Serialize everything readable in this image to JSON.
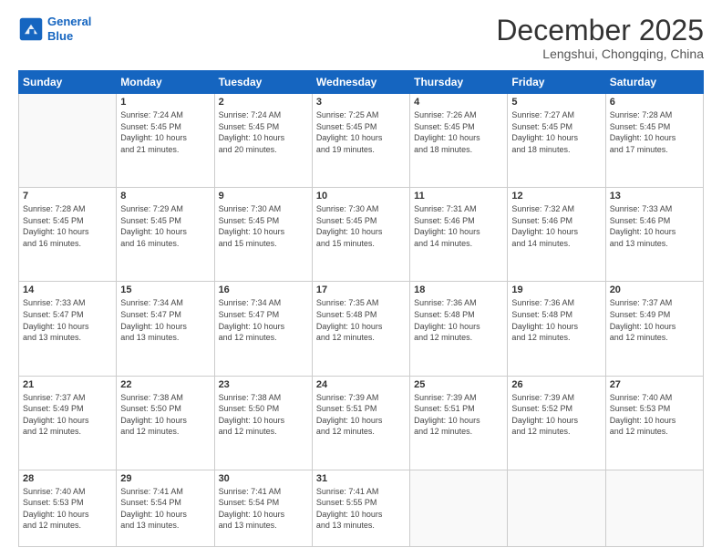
{
  "logo": {
    "line1": "General",
    "line2": "Blue"
  },
  "header": {
    "month": "December 2025",
    "location": "Lengshui, Chongqing, China"
  },
  "weekdays": [
    "Sunday",
    "Monday",
    "Tuesday",
    "Wednesday",
    "Thursday",
    "Friday",
    "Saturday"
  ],
  "weeks": [
    [
      {
        "day": "",
        "info": ""
      },
      {
        "day": "1",
        "info": "Sunrise: 7:24 AM\nSunset: 5:45 PM\nDaylight: 10 hours\nand 21 minutes."
      },
      {
        "day": "2",
        "info": "Sunrise: 7:24 AM\nSunset: 5:45 PM\nDaylight: 10 hours\nand 20 minutes."
      },
      {
        "day": "3",
        "info": "Sunrise: 7:25 AM\nSunset: 5:45 PM\nDaylight: 10 hours\nand 19 minutes."
      },
      {
        "day": "4",
        "info": "Sunrise: 7:26 AM\nSunset: 5:45 PM\nDaylight: 10 hours\nand 18 minutes."
      },
      {
        "day": "5",
        "info": "Sunrise: 7:27 AM\nSunset: 5:45 PM\nDaylight: 10 hours\nand 18 minutes."
      },
      {
        "day": "6",
        "info": "Sunrise: 7:28 AM\nSunset: 5:45 PM\nDaylight: 10 hours\nand 17 minutes."
      }
    ],
    [
      {
        "day": "7",
        "info": "Sunrise: 7:28 AM\nSunset: 5:45 PM\nDaylight: 10 hours\nand 16 minutes."
      },
      {
        "day": "8",
        "info": "Sunrise: 7:29 AM\nSunset: 5:45 PM\nDaylight: 10 hours\nand 16 minutes."
      },
      {
        "day": "9",
        "info": "Sunrise: 7:30 AM\nSunset: 5:45 PM\nDaylight: 10 hours\nand 15 minutes."
      },
      {
        "day": "10",
        "info": "Sunrise: 7:30 AM\nSunset: 5:45 PM\nDaylight: 10 hours\nand 15 minutes."
      },
      {
        "day": "11",
        "info": "Sunrise: 7:31 AM\nSunset: 5:46 PM\nDaylight: 10 hours\nand 14 minutes."
      },
      {
        "day": "12",
        "info": "Sunrise: 7:32 AM\nSunset: 5:46 PM\nDaylight: 10 hours\nand 14 minutes."
      },
      {
        "day": "13",
        "info": "Sunrise: 7:33 AM\nSunset: 5:46 PM\nDaylight: 10 hours\nand 13 minutes."
      }
    ],
    [
      {
        "day": "14",
        "info": "Sunrise: 7:33 AM\nSunset: 5:47 PM\nDaylight: 10 hours\nand 13 minutes."
      },
      {
        "day": "15",
        "info": "Sunrise: 7:34 AM\nSunset: 5:47 PM\nDaylight: 10 hours\nand 13 minutes."
      },
      {
        "day": "16",
        "info": "Sunrise: 7:34 AM\nSunset: 5:47 PM\nDaylight: 10 hours\nand 12 minutes."
      },
      {
        "day": "17",
        "info": "Sunrise: 7:35 AM\nSunset: 5:48 PM\nDaylight: 10 hours\nand 12 minutes."
      },
      {
        "day": "18",
        "info": "Sunrise: 7:36 AM\nSunset: 5:48 PM\nDaylight: 10 hours\nand 12 minutes."
      },
      {
        "day": "19",
        "info": "Sunrise: 7:36 AM\nSunset: 5:48 PM\nDaylight: 10 hours\nand 12 minutes."
      },
      {
        "day": "20",
        "info": "Sunrise: 7:37 AM\nSunset: 5:49 PM\nDaylight: 10 hours\nand 12 minutes."
      }
    ],
    [
      {
        "day": "21",
        "info": "Sunrise: 7:37 AM\nSunset: 5:49 PM\nDaylight: 10 hours\nand 12 minutes."
      },
      {
        "day": "22",
        "info": "Sunrise: 7:38 AM\nSunset: 5:50 PM\nDaylight: 10 hours\nand 12 minutes."
      },
      {
        "day": "23",
        "info": "Sunrise: 7:38 AM\nSunset: 5:50 PM\nDaylight: 10 hours\nand 12 minutes."
      },
      {
        "day": "24",
        "info": "Sunrise: 7:39 AM\nSunset: 5:51 PM\nDaylight: 10 hours\nand 12 minutes."
      },
      {
        "day": "25",
        "info": "Sunrise: 7:39 AM\nSunset: 5:51 PM\nDaylight: 10 hours\nand 12 minutes."
      },
      {
        "day": "26",
        "info": "Sunrise: 7:39 AM\nSunset: 5:52 PM\nDaylight: 10 hours\nand 12 minutes."
      },
      {
        "day": "27",
        "info": "Sunrise: 7:40 AM\nSunset: 5:53 PM\nDaylight: 10 hours\nand 12 minutes."
      }
    ],
    [
      {
        "day": "28",
        "info": "Sunrise: 7:40 AM\nSunset: 5:53 PM\nDaylight: 10 hours\nand 12 minutes."
      },
      {
        "day": "29",
        "info": "Sunrise: 7:41 AM\nSunset: 5:54 PM\nDaylight: 10 hours\nand 13 minutes."
      },
      {
        "day": "30",
        "info": "Sunrise: 7:41 AM\nSunset: 5:54 PM\nDaylight: 10 hours\nand 13 minutes."
      },
      {
        "day": "31",
        "info": "Sunrise: 7:41 AM\nSunset: 5:55 PM\nDaylight: 10 hours\nand 13 minutes."
      },
      {
        "day": "",
        "info": ""
      },
      {
        "day": "",
        "info": ""
      },
      {
        "day": "",
        "info": ""
      }
    ]
  ]
}
